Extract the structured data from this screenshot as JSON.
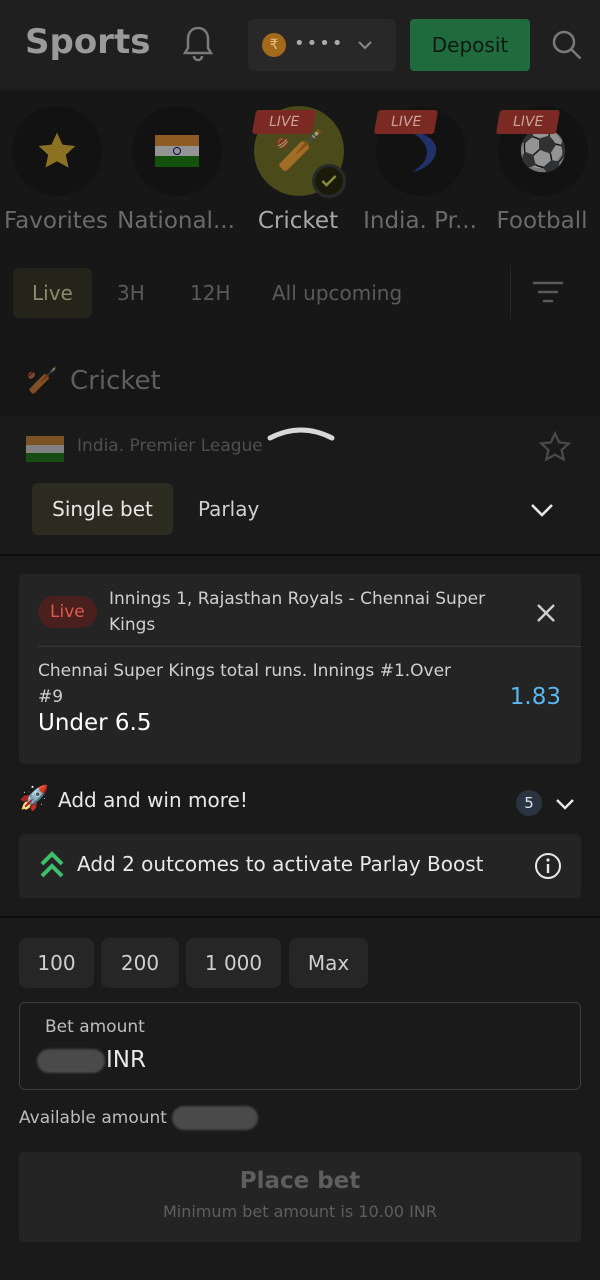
{
  "header": {
    "title": "Sports",
    "balance_mask": "••••",
    "currency_symbol": "₹",
    "deposit_label": "Deposit"
  },
  "sports": [
    {
      "label": "Favorites",
      "icon": "star-icon",
      "live": false
    },
    {
      "label": "National...",
      "icon": "india-flag-icon",
      "live": false
    },
    {
      "label": "Cricket",
      "icon": "cricket-icon",
      "live": true,
      "selected": true
    },
    {
      "label": "India. Pr...",
      "icon": "ipl-icon",
      "live": true
    },
    {
      "label": "Football",
      "icon": "football-icon",
      "live": true
    }
  ],
  "live_tag": "LIVE",
  "time_filters": [
    "Live",
    "3H",
    "12H",
    "All upcoming"
  ],
  "section": {
    "title": "Cricket",
    "league": "India. Premier League"
  },
  "betslip": {
    "tabs": [
      "Single bet",
      "Parlay"
    ],
    "selection": {
      "live_label": "Live",
      "match": "Innings 1, Rajasthan Royals - Chennai Super Kings",
      "market": "Chennai Super Kings total runs. Innings #1.Over #9",
      "outcome": "Under 6.5",
      "odds": "1.83"
    },
    "add_win": {
      "label": "Add and win more!",
      "count": "5"
    },
    "boost_text": "Add 2 outcomes to activate Parlay Boost",
    "quick_amounts": [
      "100",
      "200",
      "1 000",
      "Max"
    ],
    "amount_label": "Bet amount",
    "amount_currency": "INR",
    "available_label": "Available amount",
    "place_label": "Place bet",
    "place_sub": "Minimum bet amount is 10.00 INR"
  },
  "colors": {
    "accent_green": "#1f6b3d",
    "odds_blue": "#5ab6f0",
    "live_red": "#e0594c"
  }
}
